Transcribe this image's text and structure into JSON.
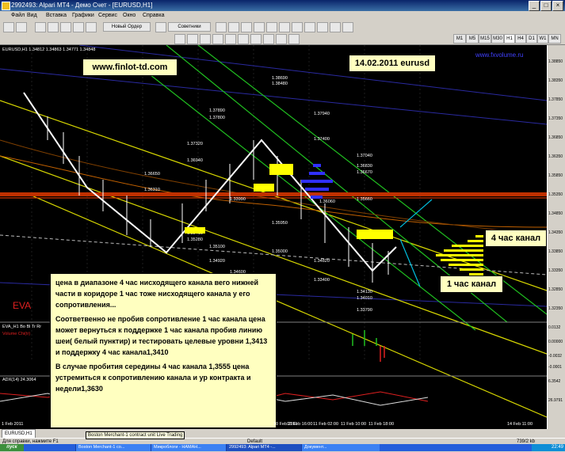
{
  "window": {
    "title": "2992493: Alpari MT4 - Демо Счет - [EURUSD,H1]"
  },
  "menu": [
    "Файл",
    "Вид",
    "Вставка",
    "Графики",
    "Сервис",
    "Окно",
    "Справка"
  ],
  "toolbar": {
    "new_order": "Новый Ордер",
    "advisors": "Советники"
  },
  "timeframes": [
    "M1",
    "M5",
    "M15",
    "M30",
    "H1",
    "H4",
    "D1",
    "W1",
    "MN"
  ],
  "chart": {
    "symbol_header": "EURUSD,H1 1.34812 1.34863 1.34771 1.34848",
    "site_label": "www.finlot-td.com",
    "date_label": "14.02.2011  eurusd",
    "fxvolume": "www.fxvolume.ru",
    "eva_label": "EVA",
    "levels": [
      {
        "text": "1.38690"
      },
      {
        "text": "1.38480"
      },
      {
        "text": "1.37940"
      },
      {
        "text": "1.37890"
      },
      {
        "text": "1.37800"
      },
      {
        "text": "1.37400"
      },
      {
        "text": "1.37320"
      },
      {
        "text": "1.37040"
      },
      {
        "text": "1.36940"
      },
      {
        "text": "1.36830"
      },
      {
        "text": "1.36670"
      },
      {
        "text": "1.36650"
      },
      {
        "text": "1.36310"
      },
      {
        "text": "1.36060"
      },
      {
        "text": "1.35660"
      },
      {
        "text": "1.35410"
      },
      {
        "text": "1.35280"
      },
      {
        "text": "1.35100"
      },
      {
        "text": "1.35000"
      },
      {
        "text": "1.34920"
      },
      {
        "text": "1.34820"
      },
      {
        "text": "1.34600"
      },
      {
        "text": "1.34130"
      },
      {
        "text": "1.34010"
      },
      {
        "text": "1.33790"
      },
      {
        "text": "1.33990"
      },
      {
        "text": "1.35950"
      },
      {
        "text": "1.33400"
      }
    ],
    "channel_4h_label": "4 час канал",
    "channel_1h_label": "1 час канал",
    "note1": "цена в диапазоне  4 час нисходящего канала вего нижней  части  в коридоре 1 час тоже нисходящего  канала у его  сопротивления...",
    "note2": "Соответвенно не пробив сопротивление 1 час канала  цена может вернуться к поддержке 1 час канала  пробив линию шеи( белый пунктир) и тестировать целевые уровни 1,3413 и поддержку 4 час канала1,3410",
    "note3": "В случае пробития  середины 4 час канала 1,3555 цена устремиться  к сопротивлению канала и ур  контракта и недели1,3630",
    "date_axis": [
      "1 Feb 2011",
      "10 Feb 2011",
      "10 Feb 16:00",
      "11 Feb 02:00",
      "11 Feb 10:00",
      "11 Feb 18:00",
      "14 Feb 11:00"
    ],
    "price_axis": [
      "1.38850",
      "1.38350",
      "1.37850",
      "1.37350",
      "1.36850",
      "1.36350",
      "1.35850",
      "1.35350",
      "1.34850",
      "1.34350",
      "1.33850",
      "1.33350",
      "1.32850",
      "1.32350"
    ],
    "indicator_labels": [
      "EVA_H1 Bo Bl Tr Rr",
      " Volume Chi(tr)",
      "ADX(14) 24.3064"
    ],
    "indicator_scale": [
      "0.0132",
      "0.00000",
      "-0.0032",
      "-0.0001",
      "6.3542",
      "26.9791"
    ]
  },
  "tabs": [
    "EURUSD,H1"
  ],
  "status": {
    "help": "Для справки, нажмите F1",
    "profile": "Default",
    "traffic": "739/2 kb",
    "tooltip": "Boston Merchant-1 contract unit Live Trading"
  },
  "taskbar": {
    "start": "пуск",
    "tasks": [
      "Boston Merchant-1 co...",
      "Микроблоги - НАМАН...",
      "2992493: Alpari MT4 -...",
      "Документ..."
    ],
    "clock": "22:49"
  }
}
